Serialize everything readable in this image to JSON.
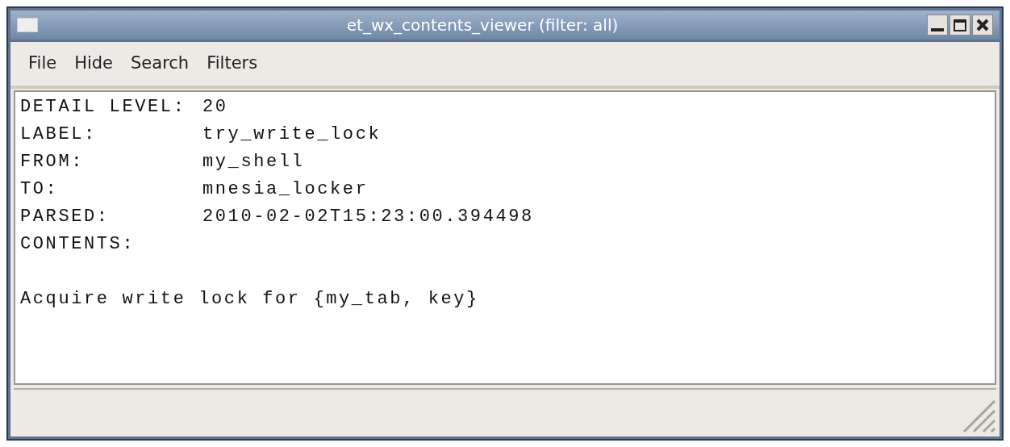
{
  "window": {
    "title": "et_wx_contents_viewer (filter: all)"
  },
  "menu": [
    "File",
    "Hide",
    "Search",
    "Filters"
  ],
  "fields": [
    {
      "label": "DETAIL LEVEL:",
      "value": "20"
    },
    {
      "label": "LABEL:",
      "value": "try_write_lock"
    },
    {
      "label": "FROM:",
      "value": "my_shell"
    },
    {
      "label": "TO:",
      "value": "mnesia_locker"
    },
    {
      "label": "PARSED:",
      "value": "2010-02-02T15:23:00.394498"
    },
    {
      "label": "CONTENTS:"
    }
  ],
  "contents": "Acquire write lock for {my_tab, key}"
}
